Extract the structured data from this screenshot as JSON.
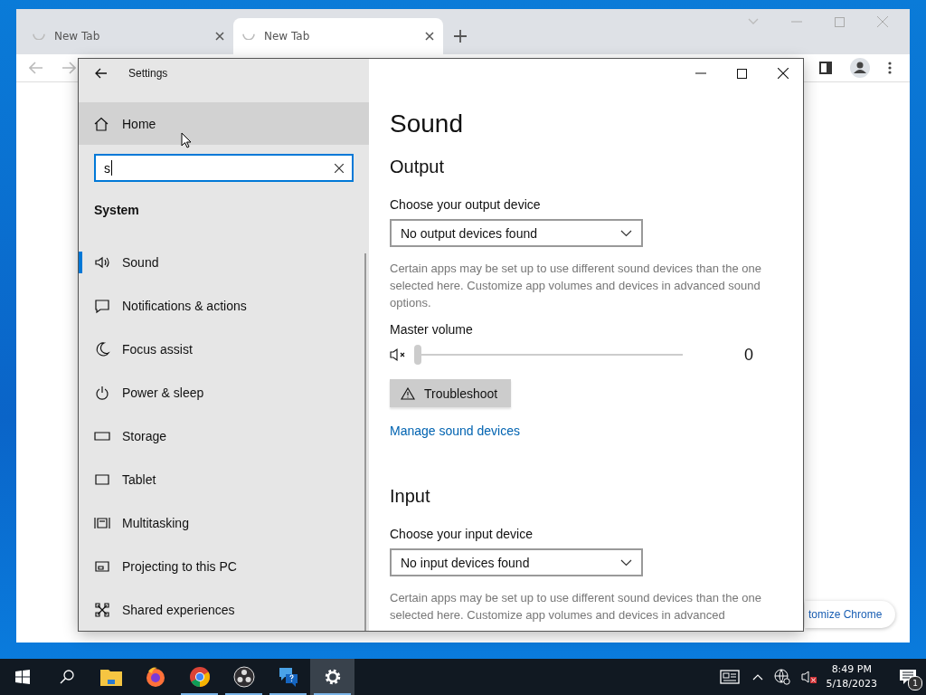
{
  "browser": {
    "tabs": [
      {
        "title": "New Tab",
        "selected": false
      },
      {
        "title": "New Tab",
        "selected": true
      }
    ],
    "customize_button": "tomize Chrome"
  },
  "settings": {
    "title": "Settings",
    "home": "Home",
    "search": {
      "value": "s"
    },
    "section": "System",
    "nav": [
      {
        "label": "Sound",
        "kind": "sound",
        "selected": true
      },
      {
        "label": "Notifications & actions",
        "kind": "notifications",
        "selected": false
      },
      {
        "label": "Focus assist",
        "kind": "focus",
        "selected": false
      },
      {
        "label": "Power & sleep",
        "kind": "power",
        "selected": false
      },
      {
        "label": "Storage",
        "kind": "storage",
        "selected": false
      },
      {
        "label": "Tablet",
        "kind": "tablet",
        "selected": false
      },
      {
        "label": "Multitasking",
        "kind": "multitasking",
        "selected": false
      },
      {
        "label": "Projecting to this PC",
        "kind": "projecting",
        "selected": false
      },
      {
        "label": "Shared experiences",
        "kind": "shared",
        "selected": false
      }
    ],
    "heading": "Sound",
    "output": {
      "heading": "Output",
      "device_label": "Choose your output device",
      "device": "No output devices found",
      "note": "Certain apps may be set up to use different sound devices than the one selected here. Customize app volumes and devices in advanced sound options.",
      "volume_label": "Master volume",
      "volume": {
        "muted": true,
        "level": 0,
        "reading": "0"
      },
      "troubleshoot": "Troubleshoot",
      "link": "Manage sound devices"
    },
    "input": {
      "heading": "Input",
      "device_label": "Choose your input device",
      "device": "No input devices found",
      "note": "Certain apps may be set up to use different sound devices than the one selected here. Customize app volumes and devices in advanced"
    }
  },
  "taskbar": {
    "apps": [
      {
        "kind": "explorer",
        "running": false,
        "selected": false
      },
      {
        "kind": "firefox",
        "running": false,
        "selected": false
      },
      {
        "kind": "chrome",
        "running": true,
        "selected": false
      },
      {
        "kind": "obs",
        "running": true,
        "selected": false
      },
      {
        "kind": "help",
        "running": true,
        "selected": false
      },
      {
        "kind": "settings",
        "running": true,
        "selected": true
      }
    ],
    "time": "8:49 PM",
    "date": "5/18/2023",
    "notifications": "1"
  }
}
